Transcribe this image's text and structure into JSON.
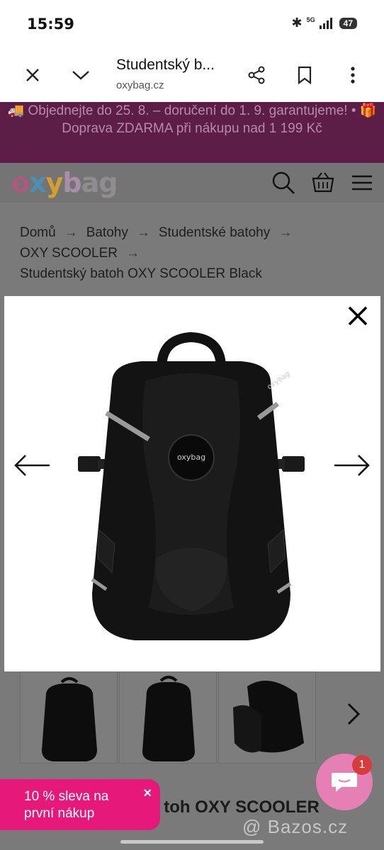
{
  "status": {
    "time": "15:59",
    "network": "5G",
    "battery": "47"
  },
  "browser": {
    "title": "Studentský b...",
    "url": "oxybag.cz"
  },
  "promo": {
    "text": "🚚 Objednejte do 25. 8. – doručení do 1. 9. garantujeme! • 🎁 Doprava ZDARMA při nákupu nad 1 199 Kč"
  },
  "logo": {
    "o": "o",
    "x": "x",
    "y": "y",
    "b": "b",
    "rest": "ag"
  },
  "breadcrumb": {
    "items": [
      "Domů",
      "Batohy",
      "Studentské batohy",
      "OXY SCOOLER",
      "Studentský batoh OXY SCOOLER Black"
    ],
    "separator": "→"
  },
  "product": {
    "title_visible": "toh OXY SCOOLER"
  },
  "discount": {
    "line1": "10 % sleva na",
    "line2": "první nákup",
    "close": "×"
  },
  "chat": {
    "badge": "1"
  },
  "watermark": {
    "text": "@ Bazos.cz"
  },
  "colors": {
    "promo_bg": "#5c1d47",
    "discount_bg": "#e6197a",
    "chat_bg": "#e680b4",
    "badge_bg": "#d83b3b"
  },
  "icons": {
    "close": "close-icon",
    "chevron": "chevron-down-icon",
    "share": "share-icon",
    "bookmark": "bookmark-icon",
    "menu": "more-vertical-icon",
    "search": "search-icon",
    "basket": "basket-icon",
    "hamburger": "hamburger-icon"
  }
}
